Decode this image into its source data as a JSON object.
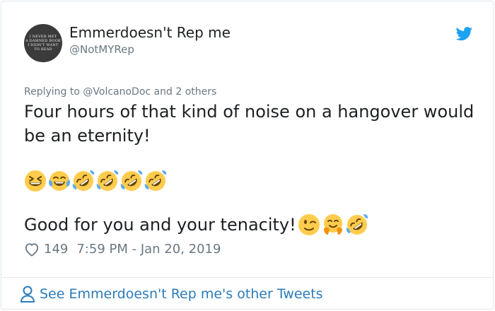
{
  "user": {
    "name": "Emmerdoesn't Rep me",
    "handle": "@NotMYRep",
    "avatar_text": [
      "I NEVER MET",
      "A DAMNED BOOK",
      "I DIDN'T WANT",
      "TO READ"
    ]
  },
  "reply_context": {
    "prefix": "Replying to ",
    "mention": "@VolcanoDoc",
    "suffix": " and 2 others"
  },
  "tweet": {
    "line1": "Four hours of that kind of noise on a hangover would",
    "line2": "be an eternity!",
    "emoji_row": [
      "grinning-squinting-face",
      "face-with-tears-of-joy",
      "rolling-on-floor-laughing",
      "rolling-on-floor-laughing",
      "rolling-on-floor-laughing",
      "rolling-on-floor-laughing"
    ],
    "line3": "Good for you and your tenacity!",
    "line3_emojis": [
      "winking-face",
      "hugging-face",
      "rolling-on-floor-laughing"
    ]
  },
  "meta": {
    "likes": "149",
    "timestamp": "7:59 PM - Jan 20, 2019"
  },
  "footer": {
    "link_text": "See Emmerdoesn't Rep me's other Tweets"
  },
  "colors": {
    "link": "#2b7bb9",
    "twitter_blue": "#1da1f2",
    "muted": "#697882",
    "emoji_yellow": "#ffcc4d"
  }
}
